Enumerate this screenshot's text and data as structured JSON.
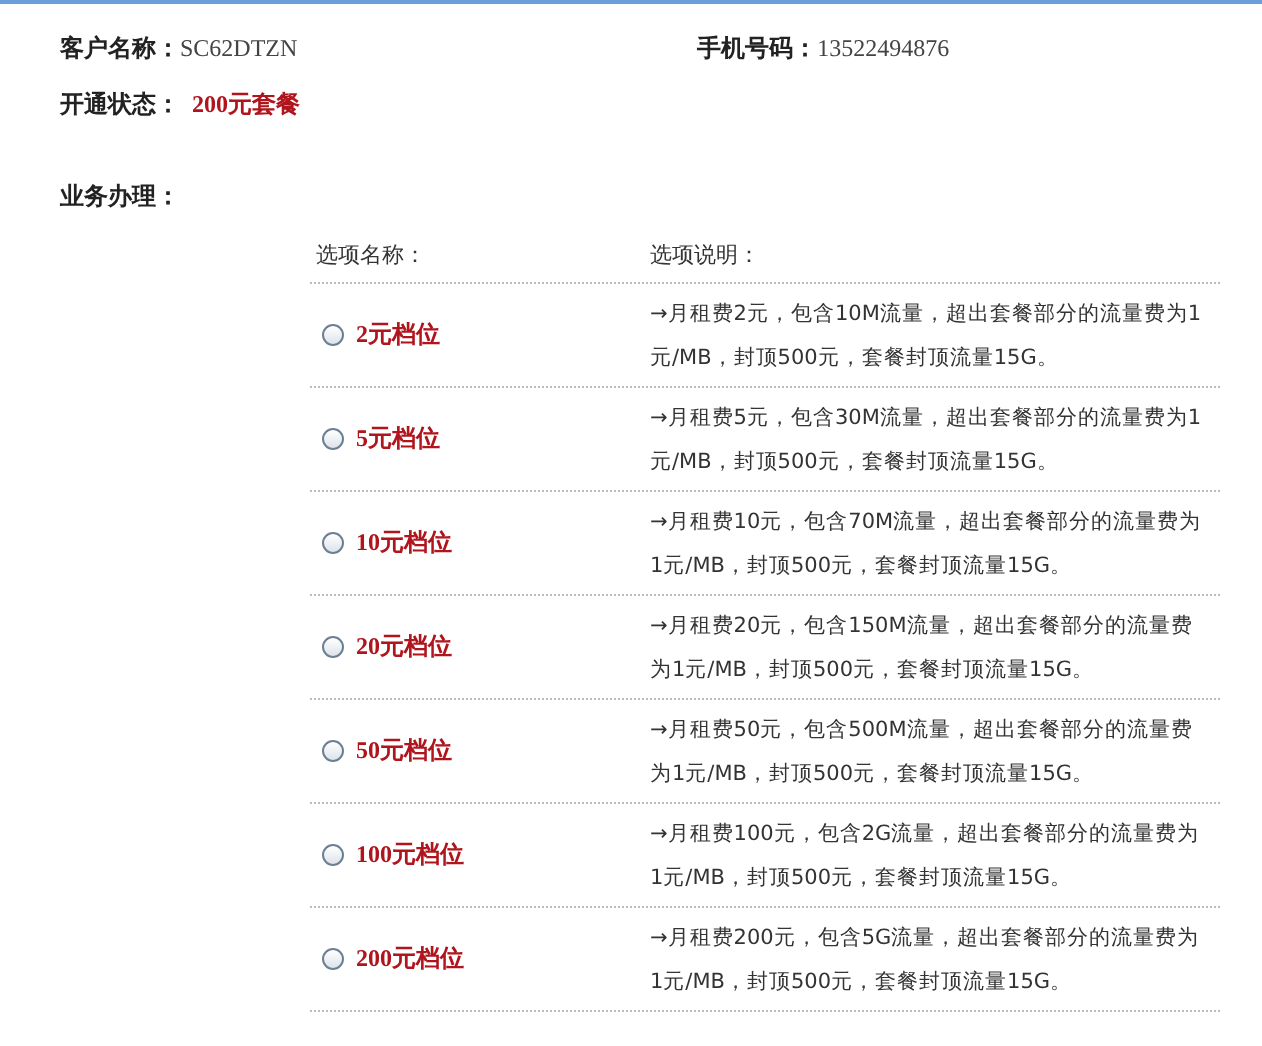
{
  "customer": {
    "name_label": "客户名称：",
    "name": "SC62DTZN",
    "phone_label": "手机号码：",
    "phone": "13522494876",
    "status_label": "开通状态：",
    "status": "200元套餐"
  },
  "section_title": "业务办理：",
  "table": {
    "columns": [
      "选项名称：",
      "选项说明："
    ],
    "rows": [
      {
        "name": "2元档位",
        "selected": false,
        "description": "→月租费2元，包含10M流量，超出套餐部分的流量费为1元/MB，封顶500元，套餐封顶流量15G。"
      },
      {
        "name": "5元档位",
        "selected": false,
        "description": "→月租费5元，包含30M流量，超出套餐部分的流量费为1元/MB，封顶500元，套餐封顶流量15G。"
      },
      {
        "name": "10元档位",
        "selected": false,
        "description": "→月租费10元，包含70M流量，超出套餐部分的流量费为1元/MB，封顶500元，套餐封顶流量15G。"
      },
      {
        "name": "20元档位",
        "selected": false,
        "description": "→月租费20元，包含150M流量，超出套餐部分的流量费为1元/MB，封顶500元，套餐封顶流量15G。"
      },
      {
        "name": "50元档位",
        "selected": false,
        "description": "→月租费50元，包含500M流量，超出套餐部分的流量费为1元/MB，封顶500元，套餐封顶流量15G。"
      },
      {
        "name": "100元档位",
        "selected": false,
        "description": "→月租费100元，包含2G流量，超出套餐部分的流量费为1元/MB，封顶500元，套餐封顶流量15G。"
      },
      {
        "name": "200元档位",
        "selected": false,
        "description": "→月租费200元，包含5G流量，超出套餐部分的流量费为1元/MB，封顶500元，套餐封顶流量15G。"
      }
    ]
  }
}
